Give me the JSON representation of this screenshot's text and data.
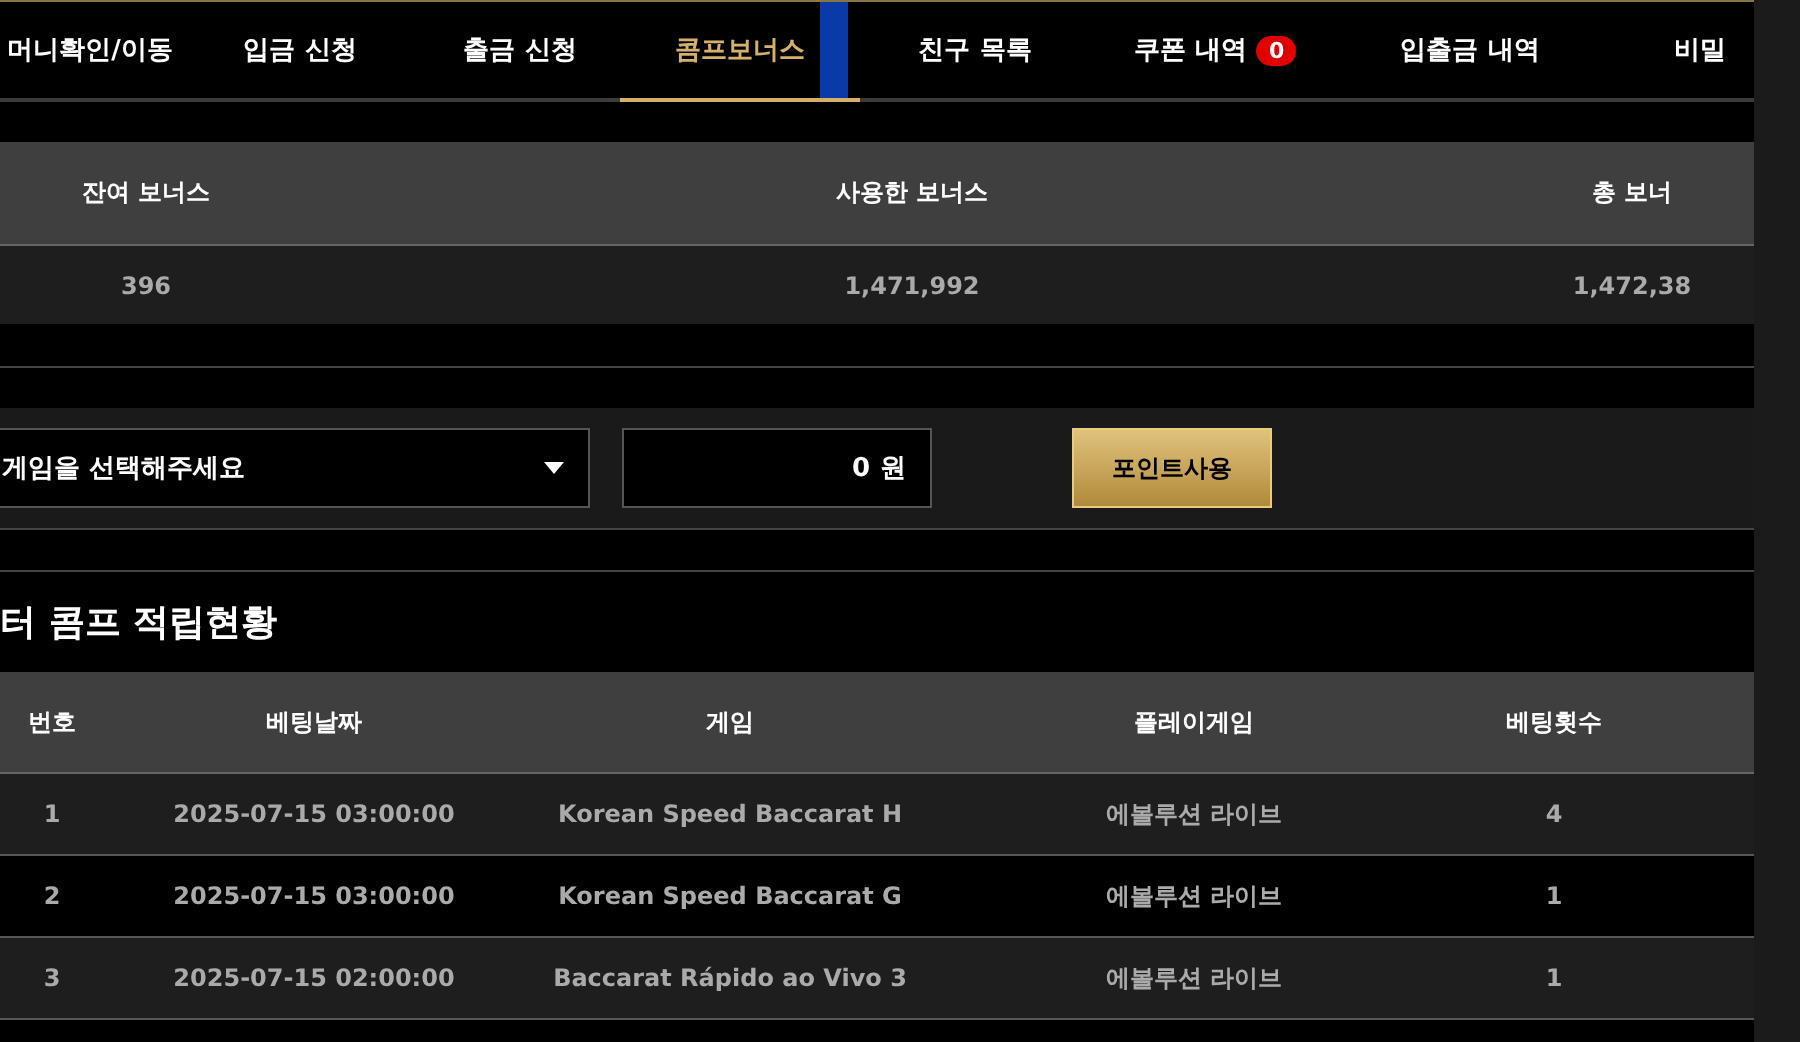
{
  "nav": [
    {
      "label": "머니확인/이동",
      "selected": false
    },
    {
      "label": "입금 신청",
      "selected": false
    },
    {
      "label": "출금 신청",
      "selected": false
    },
    {
      "label": "콤프보너스",
      "selected": true
    },
    {
      "label": "친구 목록",
      "selected": false
    },
    {
      "label": "쿠폰 내역",
      "selected": false,
      "badge": "0"
    },
    {
      "label": "입출금 내역",
      "selected": false
    },
    {
      "label": "비밀",
      "selected": false
    }
  ],
  "summary": {
    "columns": [
      "잔여 보너스",
      "사용한 보너스",
      "총 보너"
    ],
    "values": [
      "396",
      "1,471,992",
      "1,472,38"
    ]
  },
  "form": {
    "select": "게임을 선택해주세요",
    "amount": "0",
    "unit": "원",
    "button": "포인트사용"
  },
  "section_title": "터 콤프 적립현황",
  "table": {
    "columns": [
      "번호",
      "베팅날짜",
      "게임",
      "플레이게임",
      "베팅횟수"
    ],
    "rows": [
      [
        "1",
        "2025-07-15 03:00:00",
        "Korean Speed Baccarat H",
        "에볼루션 라이브",
        "4"
      ],
      [
        "2",
        "2025-07-15 03:00:00",
        "Korean Speed Baccarat G",
        "에볼루션 라이브",
        "1"
      ],
      [
        "3",
        "2025-07-15 02:00:00",
        "Baccarat Rápido ao Vivo 3",
        "에볼루션 라이브",
        "1"
      ]
    ]
  }
}
